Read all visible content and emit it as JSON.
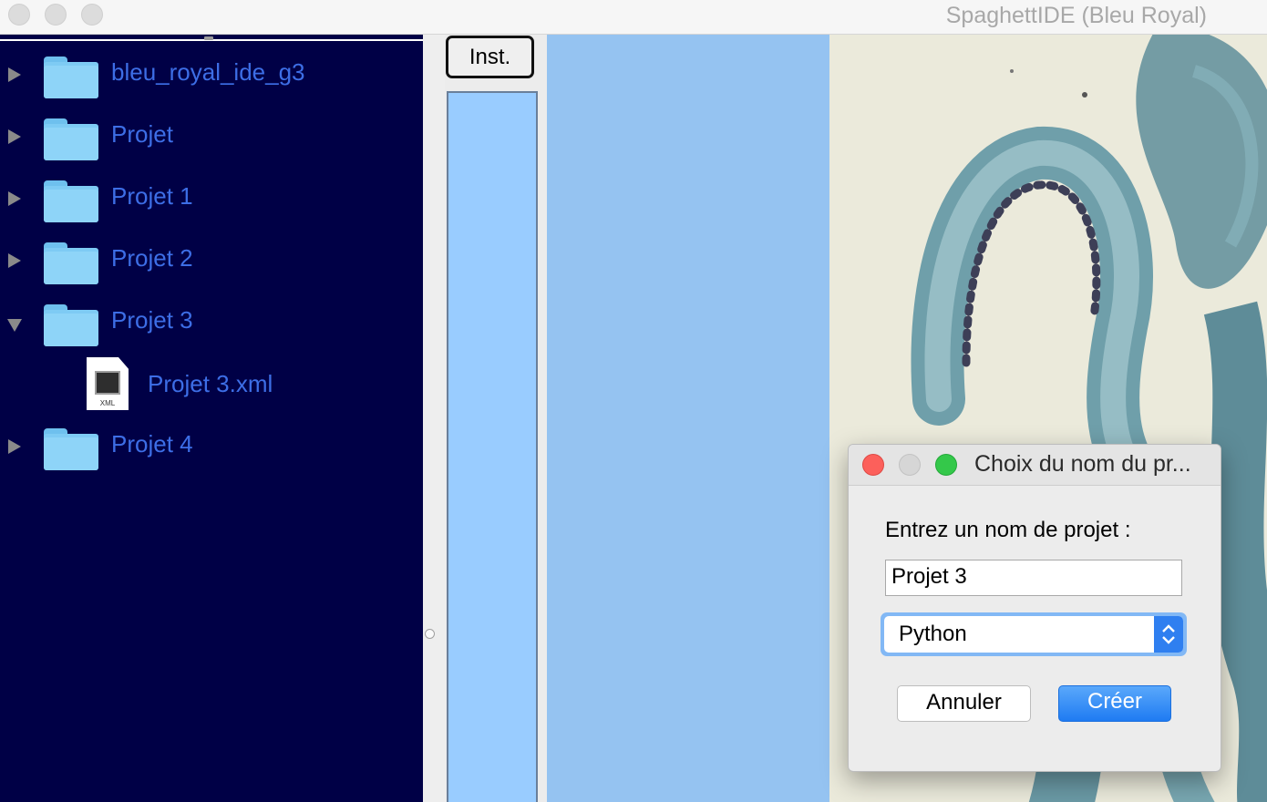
{
  "window": {
    "title": "SpaghettIDE (Bleu Royal)"
  },
  "tree": {
    "items": [
      {
        "label": "bleu_royal_ide_g3",
        "kind": "folder",
        "expanded": false
      },
      {
        "label": "Projet",
        "kind": "folder",
        "expanded": false
      },
      {
        "label": "Projet 1",
        "kind": "folder",
        "expanded": false
      },
      {
        "label": "Projet 2",
        "kind": "folder",
        "expanded": false
      },
      {
        "label": "Projet 3",
        "kind": "folder",
        "expanded": true
      },
      {
        "label": "Projet 3.xml",
        "kind": "file",
        "icon_caption": "XML"
      },
      {
        "label": "Projet 4",
        "kind": "folder",
        "expanded": false
      }
    ]
  },
  "toolbar": {
    "inst_label": "Inst."
  },
  "dialog": {
    "title": "Choix du nom du pr...",
    "prompt": "Entrez un nom de projet :",
    "name_value": "Projet 3",
    "language_value": "Python",
    "cancel_label": "Annuler",
    "create_label": "Créer"
  },
  "colors": {
    "sidebar_bg": "#000046",
    "tree_label": "#3d6ee6",
    "editor_bg": "#95c3f1",
    "inst_panel_bg": "#99ccff",
    "accent": "#2f7ff0"
  }
}
